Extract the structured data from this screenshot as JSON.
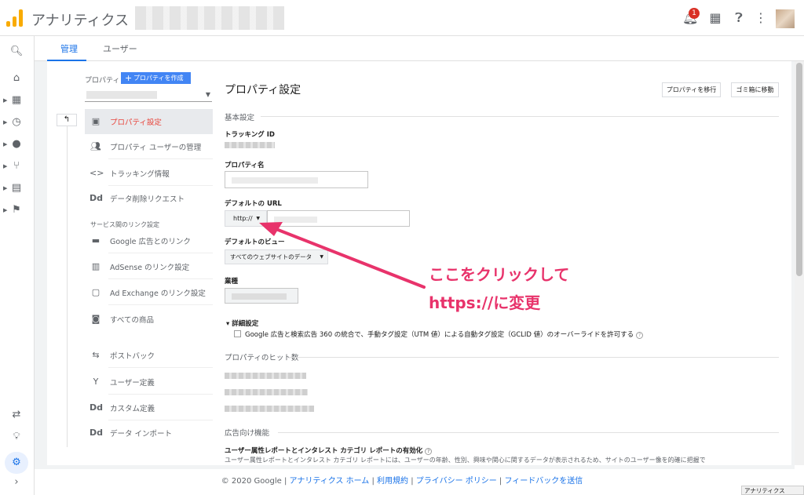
{
  "app": {
    "title": "アナリティクス",
    "notifications": "1"
  },
  "tabs": [
    {
      "label": "管理"
    },
    {
      "label": "ユーザー"
    }
  ],
  "sidebar": {
    "property_label": "プロパティ",
    "create_button": "プロパティを作成",
    "items": [
      {
        "label": "プロパティ設定",
        "icon": "layout-icon"
      },
      {
        "label": "プロパティ ユーザーの管理",
        "icon": "people-icon"
      },
      {
        "label": "トラッキング情報",
        "icon": "code-icon"
      },
      {
        "label": "データ削除リクエスト",
        "icon": "dd-icon"
      }
    ],
    "section_title": "サービス間のリンク設定",
    "link_items": [
      {
        "label": "Google 広告とのリンク"
      },
      {
        "label": "AdSense のリンク設定"
      },
      {
        "label": "Ad Exchange のリンク設定"
      },
      {
        "label": "すべての商品"
      }
    ],
    "other_items": [
      {
        "label": "ポストバック"
      },
      {
        "label": "ユーザー定義"
      },
      {
        "label": "カスタム定義"
      },
      {
        "label": "データ インポート"
      }
    ]
  },
  "main": {
    "title": "プロパティ設定",
    "move_button": "プロパティを移行",
    "trash_button": "ゴミ箱に移動",
    "basic_section": "基本設定",
    "tracking_id_label": "トラッキング ID",
    "property_name_label": "プロパティ名",
    "default_url_label": "デフォルトの URL",
    "protocol": "http://",
    "default_view_label": "デフォルトのビュー",
    "default_view_value": "すべてのウェブサイトのデータ",
    "industry_label": "業種",
    "advanced_label": "詳細設定",
    "advanced_checkbox": "Google 広告と検索広告 360 の統合で、手動タグ設定（UTM 値）による自動タグ設定（GCLID 値）のオーバーライドを許可する",
    "hits_section": "プロパティのヒット数",
    "ads_section": "広告向け機能",
    "demographics_label": "ユーザー属性レポートとインタレスト カテゴリ レポートの有効化",
    "demographics_desc": "ユーザー属性レポートとインタレスト カテゴリ レポートには、ユーザーの年齢、性別、興味や関心に関するデータが表示されるため、サイトのユーザー像を的確に把握で"
  },
  "annotation": {
    "line1": "ここをクリックして",
    "line2": "https://に変更",
    "color": "#e8336b"
  },
  "footer": {
    "copyright": "© 2020 Google",
    "links": [
      "アナリティクス ホーム",
      "利用規約",
      "プライバシー ポリシー",
      "フィードバックを送信"
    ]
  },
  "status_tooltip": "アナリティクス"
}
